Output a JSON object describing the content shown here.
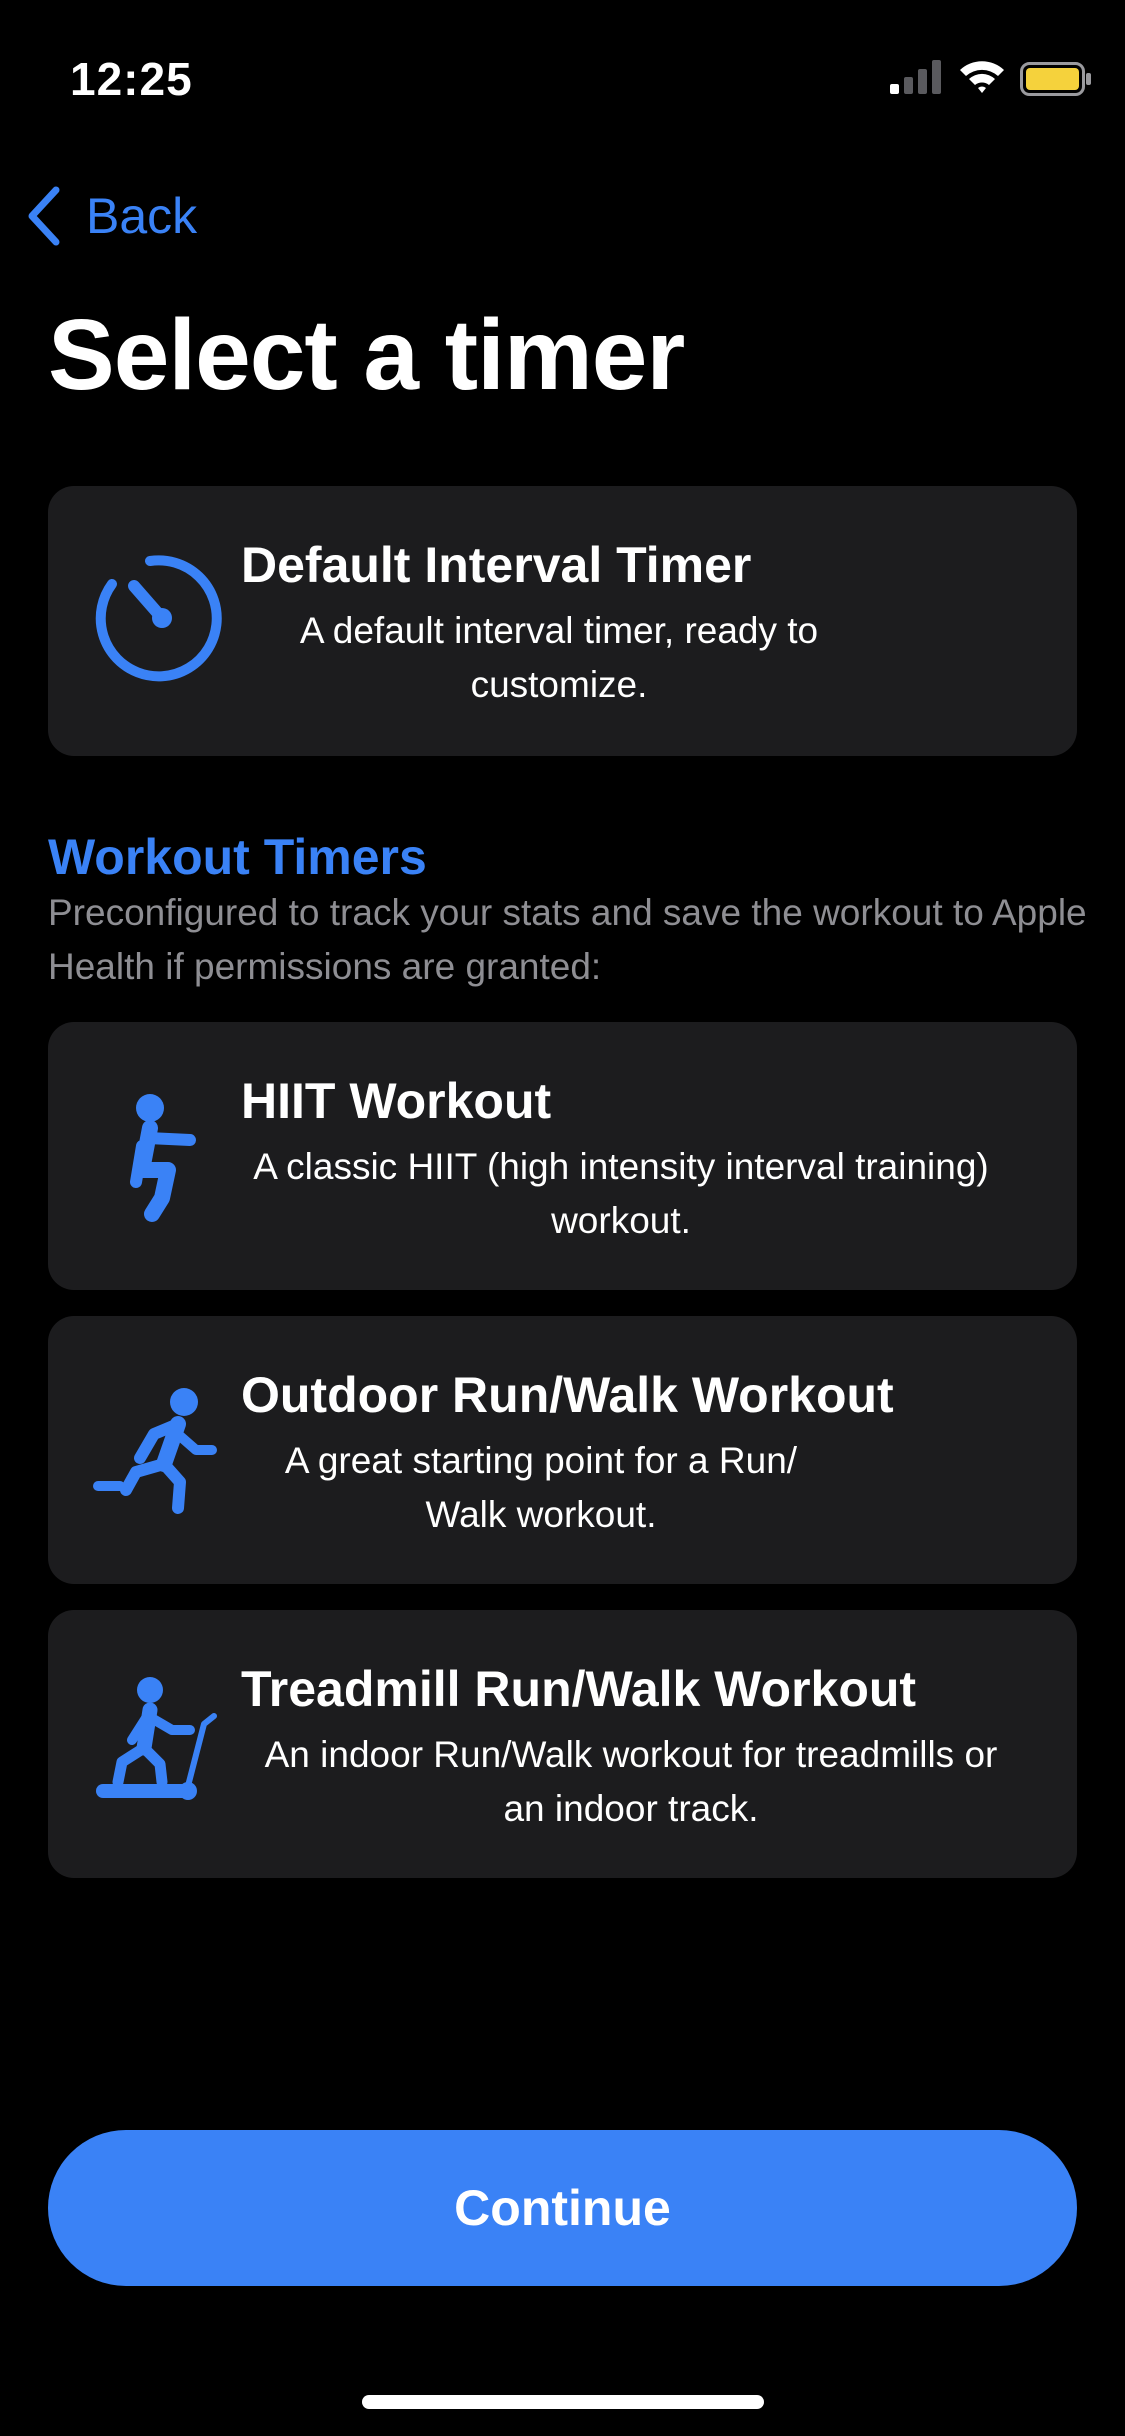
{
  "status_bar": {
    "time": "12:25",
    "battery_color": "#f5d23c"
  },
  "nav": {
    "back_label": "Back"
  },
  "page": {
    "title": "Select a timer"
  },
  "default_timer": {
    "title": "Default Interval Timer",
    "description": "A default interval timer, ready to customize.",
    "icon": "timer-icon"
  },
  "workout_section": {
    "title": "Workout Timers",
    "subtitle": "Preconfigured to track your stats and save the workout to Apple Health if permissions are granted:"
  },
  "workouts": [
    {
      "title": "HIIT Workout",
      "description": "A classic HIIT (high intensity interval training) workout.",
      "icon": "hiit-figure-icon"
    },
    {
      "title": "Outdoor Run/Walk Workout",
      "description": "A great starting point for a Run/ Walk workout.",
      "icon": "running-figure-icon"
    },
    {
      "title": "Treadmill Run/Walk Workout",
      "description": "An indoor Run/Walk workout for treadmills or an indoor track.",
      "icon": "treadmill-figure-icon"
    }
  ],
  "actions": {
    "continue_label": "Continue"
  },
  "colors": {
    "accent": "#3a82f6",
    "background": "#000000",
    "card": "#1c1c1e",
    "secondary_text": "#8e8e93"
  }
}
